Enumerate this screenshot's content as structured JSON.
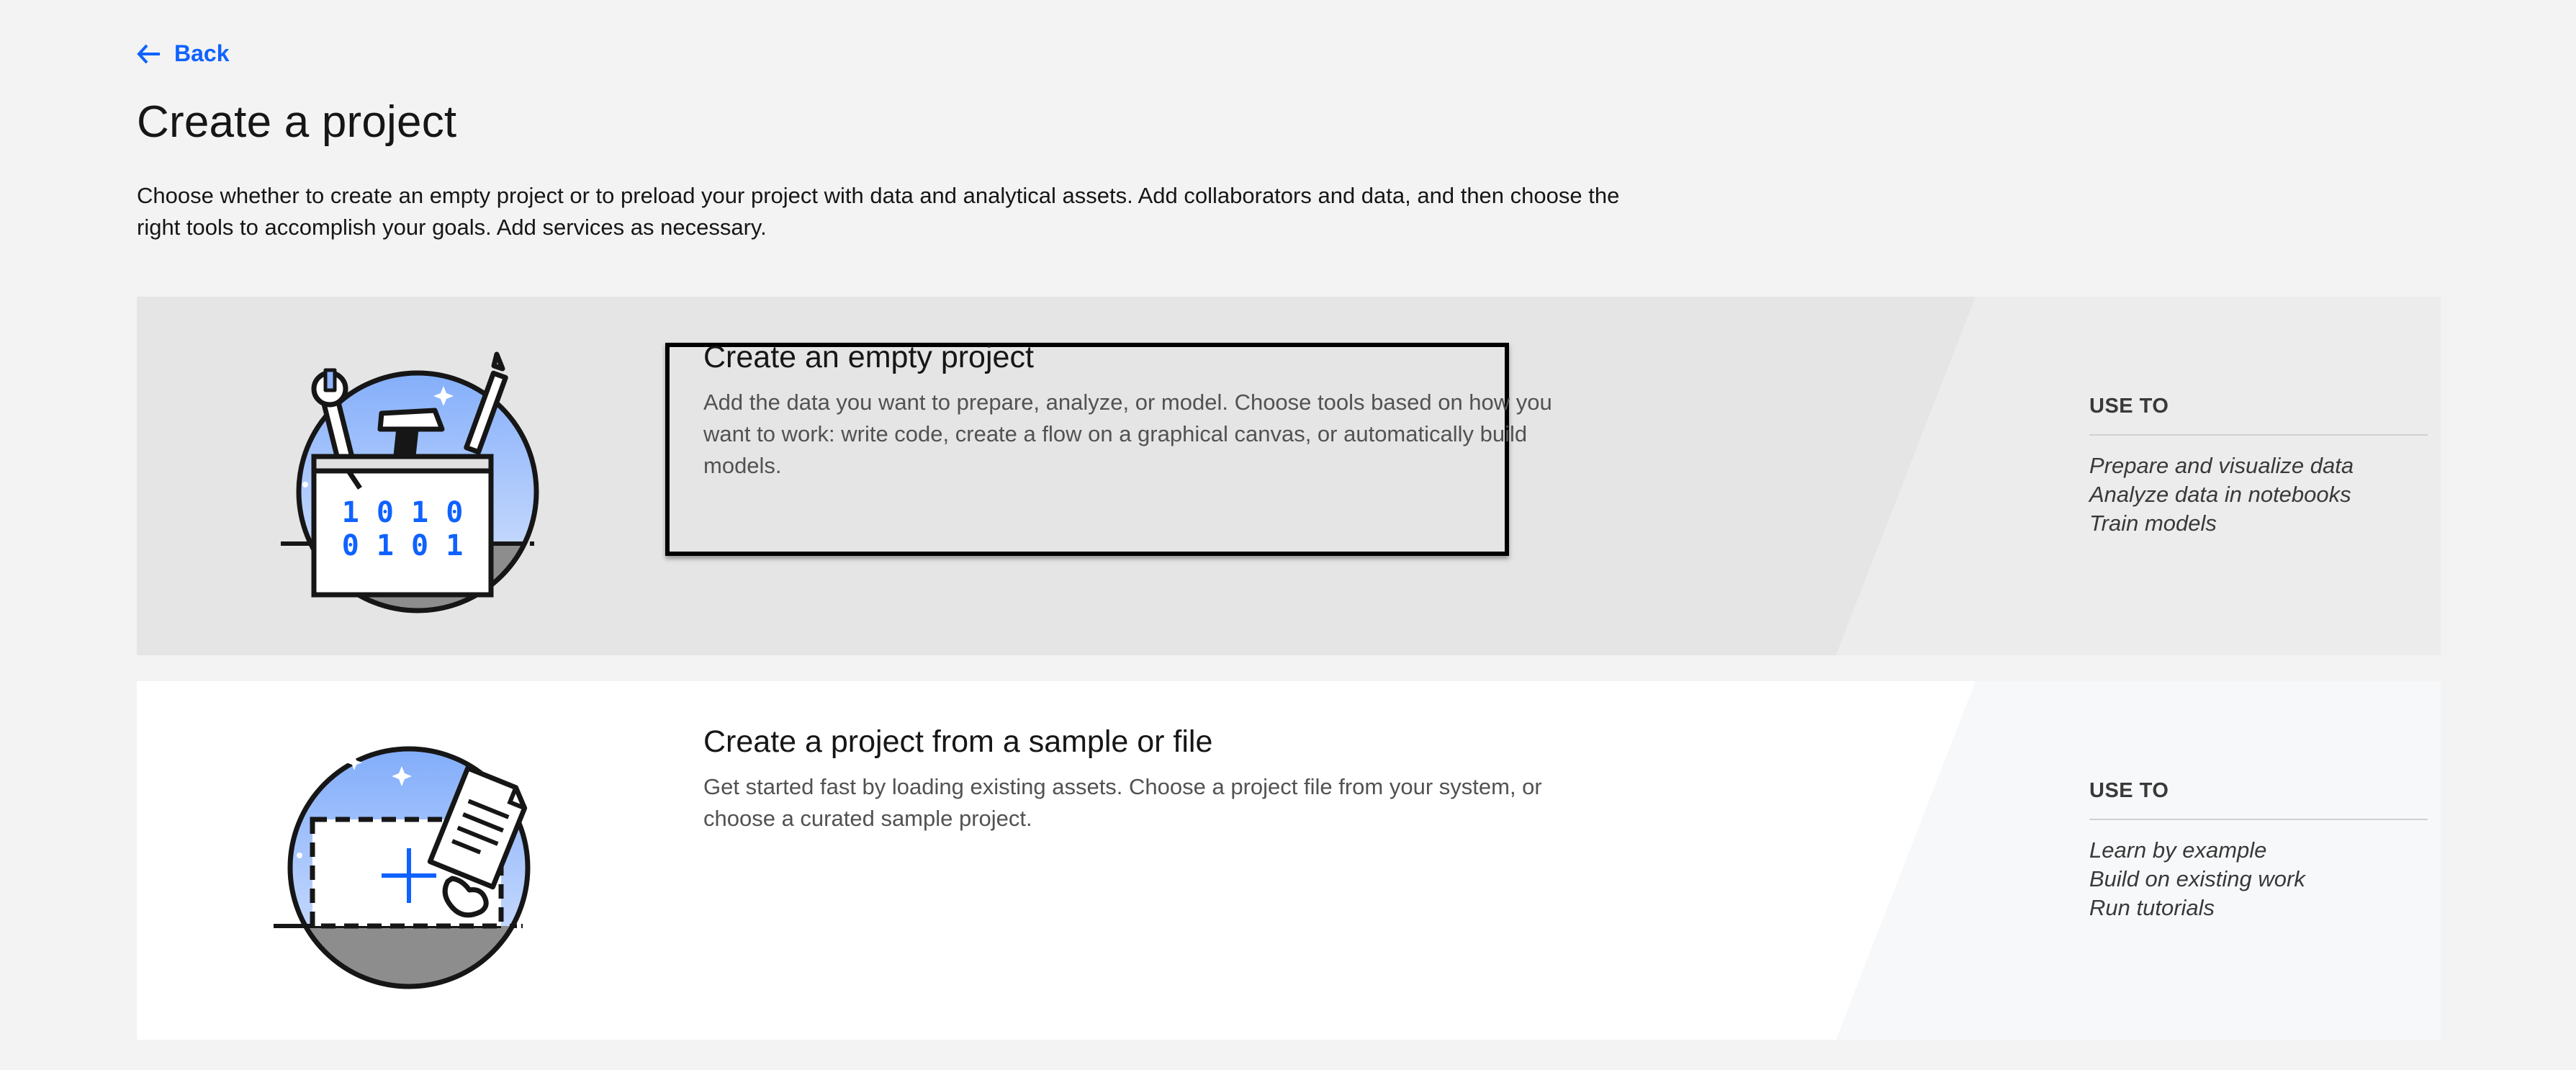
{
  "nav": {
    "back_label": "Back"
  },
  "header": {
    "title": "Create a project",
    "description": "Choose whether to create an empty project or to preload your project with data and analytical assets. Add collaborators and data, and then choose the right tools to accomplish your goals. Add services as necessary."
  },
  "options": [
    {
      "title": "Create an empty project",
      "description": "Add the data you want to prepare, analyze, or model. Choose tools based on how you want to work: write code, create a flow on a graphical canvas, or automatically build models.",
      "use_to_heading": "USE TO",
      "use_to": [
        "Prepare and visualize data",
        "Analyze data in notebooks",
        "Train models"
      ],
      "illustration": {
        "binary_line_1": "1 0 1 0",
        "binary_line_2": "0 1 0 1"
      }
    },
    {
      "title": "Create a project from a sample or file",
      "description": "Get started fast by loading existing assets. Choose a project file from your system, or choose a curated sample project.",
      "use_to_heading": "USE TO",
      "use_to": [
        "Learn by example",
        "Build on existing work",
        "Run tutorials"
      ]
    }
  ],
  "colors": {
    "accent": "#0f62fe",
    "page_background": "#f3f3f3",
    "selected_card_background": "#e5e5e5",
    "card_background": "#ffffff",
    "illustration_sky": "#8fb5fb",
    "illustration_ground": "#8d8d8d"
  },
  "icons": {
    "back": "arrow-left-icon",
    "option_1": "toolbox-illustration",
    "option_2": "upload-file-illustration"
  }
}
